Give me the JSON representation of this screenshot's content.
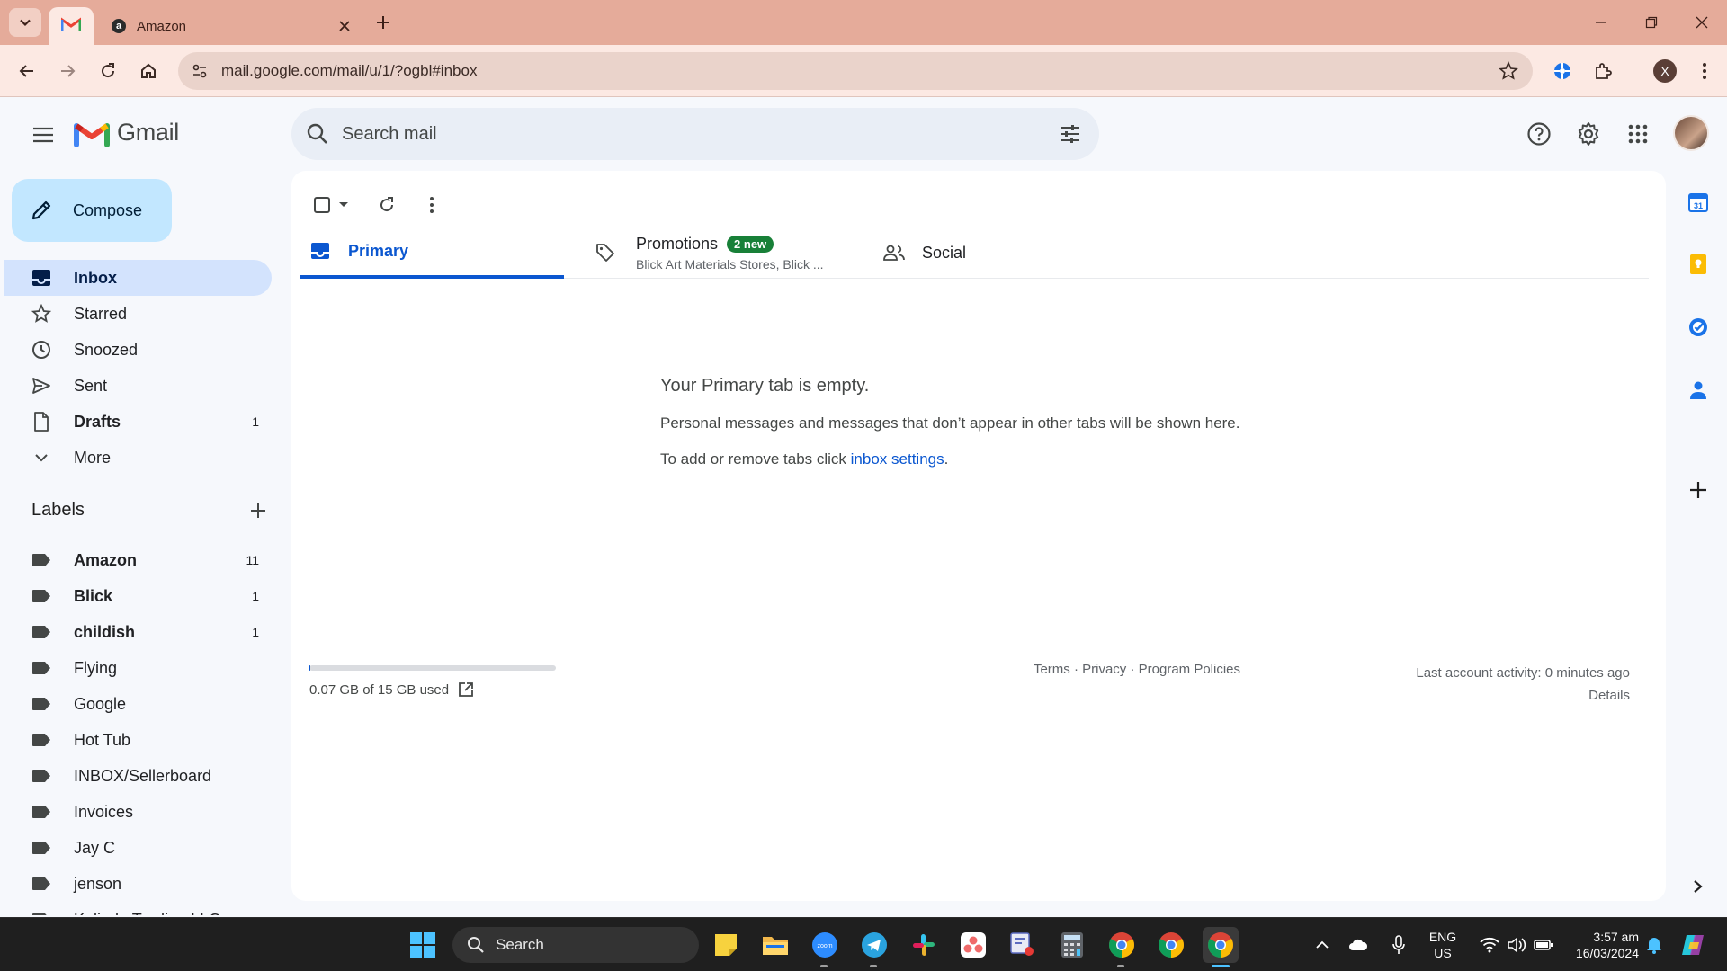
{
  "browser": {
    "tabs": [
      {
        "title": "",
        "icon": "gmail-favicon"
      },
      {
        "title": "Amazon",
        "icon": "amazon-favicon"
      }
    ],
    "url": "mail.google.com/mail/u/1/?ogbl#inbox",
    "profile_initial": "X"
  },
  "gmail": {
    "logo_text": "Gmail",
    "search_placeholder": "Search mail",
    "compose_label": "Compose",
    "nav": [
      {
        "label": "Inbox",
        "count": "",
        "icon": "inbox-icon",
        "active": true
      },
      {
        "label": "Starred",
        "count": "",
        "icon": "star-icon"
      },
      {
        "label": "Snoozed",
        "count": "",
        "icon": "clock-icon"
      },
      {
        "label": "Sent",
        "count": "",
        "icon": "send-icon"
      },
      {
        "label": "Drafts",
        "count": "1",
        "icon": "draft-icon"
      },
      {
        "label": "More",
        "count": "",
        "icon": "chevron-down-icon"
      }
    ],
    "labels_title": "Labels",
    "labels": [
      {
        "label": "Amazon",
        "count": "11",
        "bold": true
      },
      {
        "label": "Blick",
        "count": "1",
        "bold": true
      },
      {
        "label": "childish",
        "count": "1",
        "bold": true
      },
      {
        "label": "Flying",
        "count": ""
      },
      {
        "label": "Google",
        "count": ""
      },
      {
        "label": "Hot Tub",
        "count": ""
      },
      {
        "label": "INBOX/Sellerboard",
        "count": ""
      },
      {
        "label": "Invoices",
        "count": ""
      },
      {
        "label": "Jay C",
        "count": ""
      },
      {
        "label": "jenson",
        "count": ""
      },
      {
        "label": "Kalinda Trading LLC",
        "count": ""
      }
    ],
    "tabs": {
      "primary": "Primary",
      "promotions": "Promotions",
      "promotions_badge": "2 new",
      "promotions_snippet": "Blick Art Materials Stores, Blick ...",
      "social": "Social"
    },
    "empty": {
      "title": "Your Primary tab is empty.",
      "line1": "Personal messages and messages that don’t appear in other tabs will be shown here.",
      "line2_prefix": "To add or remove tabs click ",
      "line2_link": "inbox settings",
      "line2_suffix": "."
    },
    "footer": {
      "storage": "0.07 GB of 15 GB used",
      "storage_fraction": 0.005,
      "links": "Terms · Privacy · Program Policies",
      "activity": "Last account activity: 0 minutes ago",
      "details": "Details"
    }
  },
  "taskbar": {
    "search": "Search",
    "lang_top": "ENG",
    "lang_bottom": "US",
    "time": "3:57 am",
    "date": "16/03/2024"
  }
}
